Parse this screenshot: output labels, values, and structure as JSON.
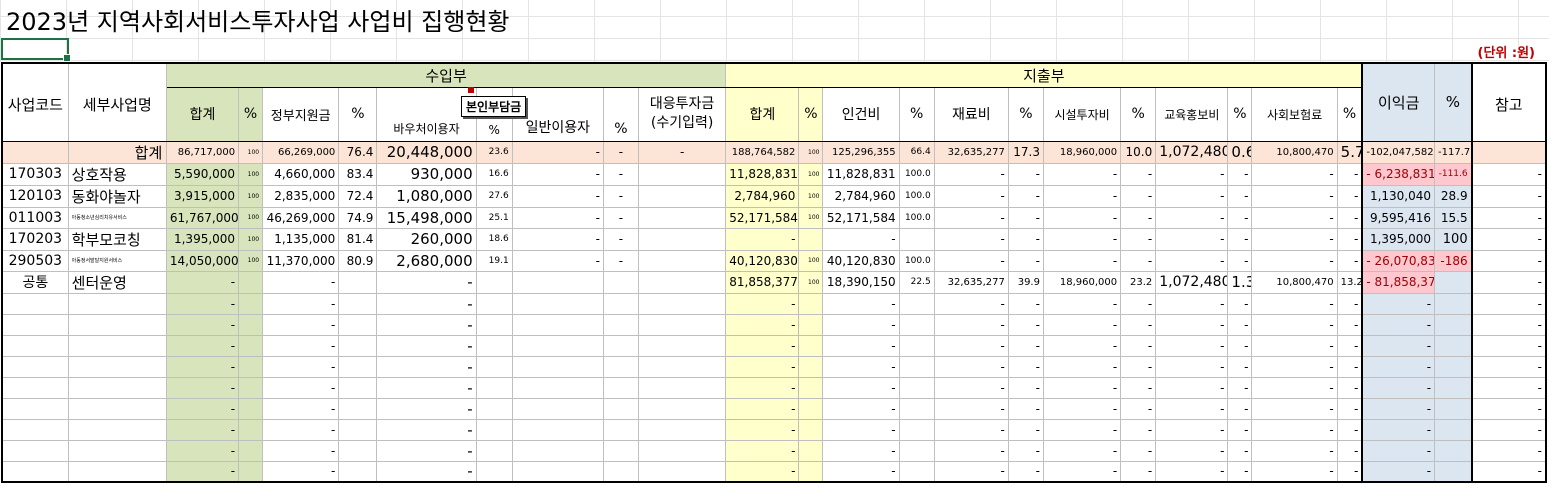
{
  "title": "2023년 지역사회서비스투자사업 사업비 집행현황",
  "unit": "(단위 :원)",
  "tooltip": "본인부담금",
  "headers": {
    "code": "사업코드",
    "name": "세부사업명",
    "income": "수입부",
    "expense": "지출부",
    "profit": "이익금",
    "profit_pct": "%",
    "note": "참고",
    "in_total": "합계",
    "in_pct": "%",
    "gov": "정부지원금",
    "gov_pct": "%",
    "voucher": "바우처이용자",
    "voucher_pct": "%",
    "general": "일반이용자",
    "general_pct": "%",
    "match_1": "대응투자금",
    "match_2": "(수기입력)",
    "out_total": "합계",
    "out_pct": "%",
    "labor": "인건비",
    "labor_pct": "%",
    "material": "재료비",
    "material_pct": "%",
    "facility": "시설투자비",
    "facility_pct": "%",
    "edu": "교육홍보비",
    "edu_pct": "%",
    "insurance": "사회보험료",
    "insurance_pct": "%"
  },
  "total_row": [
    "",
    "합계",
    "86,717,000",
    "100",
    "66,269,000",
    "76.4",
    "20,448,000",
    "23.6",
    "-",
    "-",
    "-",
    "188,764,582",
    "100",
    "125,296,355",
    "66.4",
    "32,635,277",
    "17.3",
    "18,960,000",
    "10.0",
    "1,072,480",
    "0.6",
    "10,800,470",
    "5.7",
    "-102,047,582",
    "-117.7",
    ""
  ],
  "rows": [
    [
      "170303",
      "상호작용",
      "5,590,000",
      "100",
      "4,660,000",
      "83.4",
      "930,000",
      "16.6",
      "-",
      "-",
      "",
      "11,828,831",
      "100",
      "11,828,831",
      "100.0",
      "-",
      "-",
      "-",
      "-",
      "-",
      "-",
      "-",
      "-",
      "- 6,238,831",
      "-111.6",
      "-"
    ],
    [
      "120103",
      "동화야놀자",
      "3,915,000",
      "100",
      "2,835,000",
      "72.4",
      "1,080,000",
      "27.6",
      "-",
      "-",
      "",
      "2,784,960",
      "100",
      "2,784,960",
      "100.0",
      "-",
      "-",
      "-",
      "-",
      "-",
      "-",
      "-",
      "-",
      "1,130,040",
      "28.9",
      "-"
    ],
    [
      "011003",
      "아동청소년심리치유서비스",
      "61,767,000",
      "100",
      "46,269,000",
      "74.9",
      "15,498,000",
      "25.1",
      "-",
      "-",
      "",
      "52,171,584",
      "100",
      "52,171,584",
      "100.0",
      "-",
      "-",
      "-",
      "-",
      "-",
      "-",
      "-",
      "-",
      "9,595,416",
      "15.5",
      "-"
    ],
    [
      "170203",
      "학부모코칭",
      "1,395,000",
      "100",
      "1,135,000",
      "81.4",
      "260,000",
      "18.6",
      "-",
      "-",
      "",
      "-",
      "",
      "-",
      "",
      "-",
      "-",
      "-",
      "-",
      "-",
      "-",
      "-",
      "-",
      "1,395,000",
      "100",
      "-"
    ],
    [
      "290503",
      "아동정서발달지원서비스",
      "14,050,000",
      "100",
      "11,370,000",
      "80.9",
      "2,680,000",
      "19.1",
      "-",
      "-",
      "",
      "40,120,830",
      "100",
      "40,120,830",
      "100.0",
      "-",
      "-",
      "-",
      "-",
      "-",
      "-",
      "-",
      "-",
      "- 26,070,830",
      "-186",
      "-"
    ],
    [
      "공통",
      "센터운영",
      "-",
      "",
      "-",
      "",
      "-",
      "",
      "",
      "",
      "",
      "81,858,377",
      "100",
      "18,390,150",
      "22.5",
      "32,635,277",
      "39.9",
      "18,960,000",
      "23.2",
      "1,072,480",
      "1.3",
      "10,800,470",
      "13.2",
      "- 81,858,377",
      "",
      "-"
    ]
  ],
  "empty_row": [
    "",
    "",
    "-",
    "",
    "-",
    "",
    "-",
    "",
    "",
    "",
    "",
    "-",
    "",
    "-",
    "",
    "-",
    "-",
    "-",
    "-",
    "-",
    "-",
    "-",
    "-",
    "-",
    "",
    "-"
  ],
  "empty_row_count": 9
}
